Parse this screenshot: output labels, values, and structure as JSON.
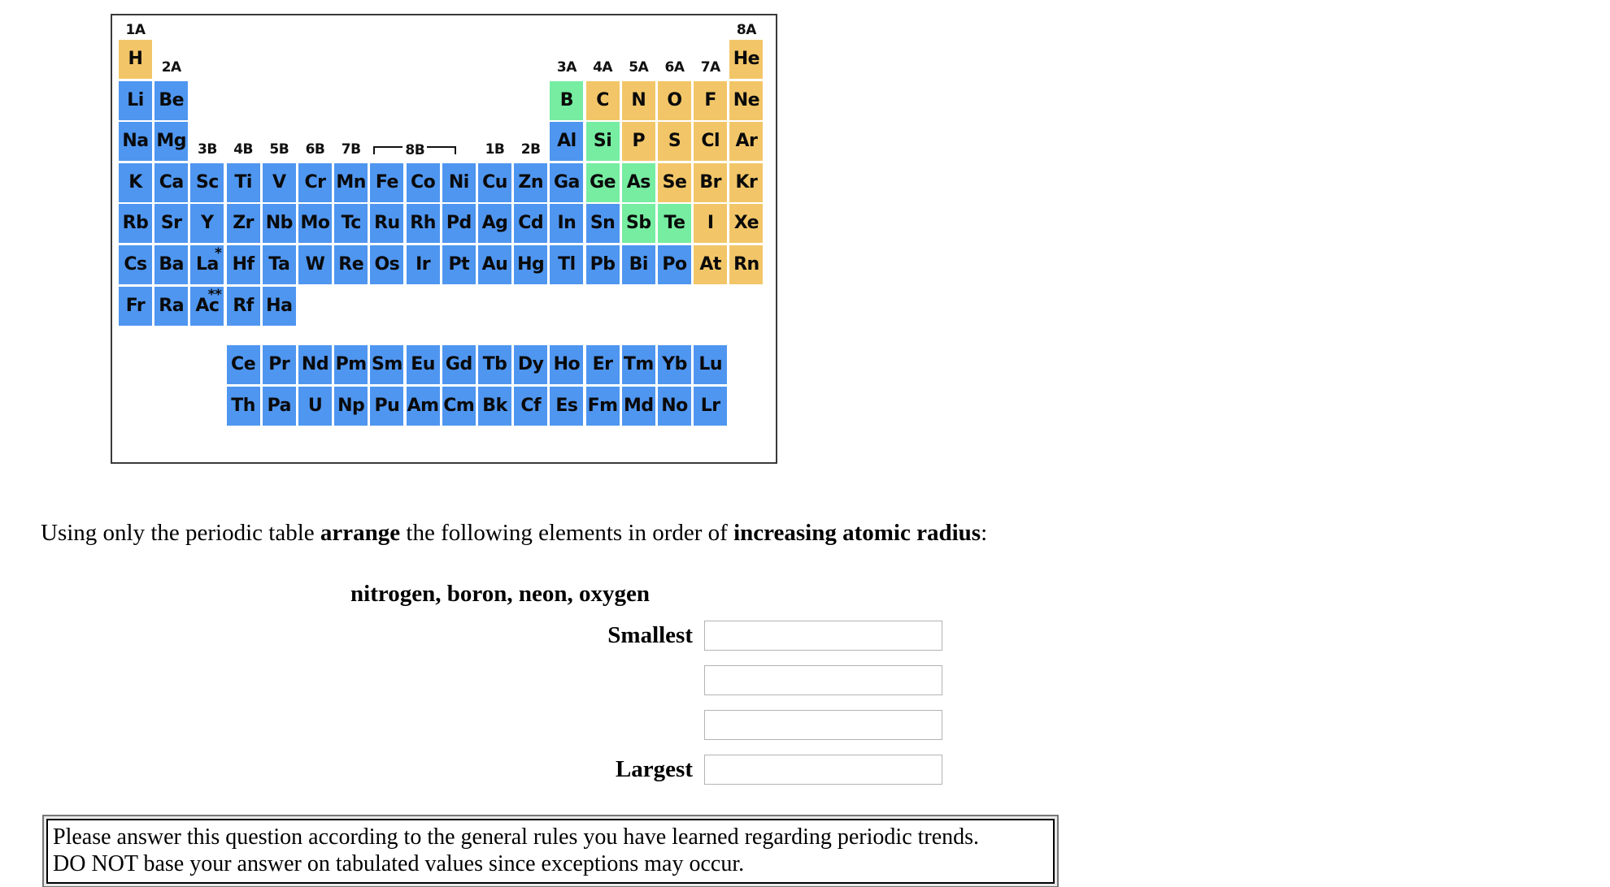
{
  "periodic_table": {
    "colors": {
      "metal": "#4f96f0",
      "metalloid": "#76eda1",
      "nonmetal": "#f2c668",
      "frame": "#3a3a3a"
    },
    "group_labels": [
      "1A",
      "2A",
      "3A",
      "4A",
      "5A",
      "6A",
      "7A",
      "8A",
      "3B",
      "4B",
      "5B",
      "6B",
      "7B",
      "8B",
      "1B",
      "2B"
    ],
    "main_rows": [
      {
        "row": 1,
        "cells": [
          {
            "sym": "H",
            "col": 1,
            "type": "nonmetal"
          },
          {
            "sym": "He",
            "col": 18,
            "type": "nonmetal"
          }
        ]
      },
      {
        "row": 2,
        "cells": [
          {
            "sym": "Li",
            "col": 1,
            "type": "metal"
          },
          {
            "sym": "Be",
            "col": 2,
            "type": "metal"
          },
          {
            "sym": "B",
            "col": 13,
            "type": "metalloid"
          },
          {
            "sym": "C",
            "col": 14,
            "type": "nonmetal"
          },
          {
            "sym": "N",
            "col": 15,
            "type": "nonmetal"
          },
          {
            "sym": "O",
            "col": 16,
            "type": "nonmetal"
          },
          {
            "sym": "F",
            "col": 17,
            "type": "nonmetal"
          },
          {
            "sym": "Ne",
            "col": 18,
            "type": "nonmetal"
          }
        ]
      },
      {
        "row": 3,
        "cells": [
          {
            "sym": "Na",
            "col": 1,
            "type": "metal"
          },
          {
            "sym": "Mg",
            "col": 2,
            "type": "metal"
          },
          {
            "sym": "Al",
            "col": 13,
            "type": "metal"
          },
          {
            "sym": "Si",
            "col": 14,
            "type": "metalloid"
          },
          {
            "sym": "P",
            "col": 15,
            "type": "nonmetal"
          },
          {
            "sym": "S",
            "col": 16,
            "type": "nonmetal"
          },
          {
            "sym": "Cl",
            "col": 17,
            "type": "nonmetal"
          },
          {
            "sym": "Ar",
            "col": 18,
            "type": "nonmetal"
          }
        ]
      },
      {
        "row": 4,
        "cells": [
          {
            "sym": "K",
            "col": 1,
            "type": "metal"
          },
          {
            "sym": "Ca",
            "col": 2,
            "type": "metal"
          },
          {
            "sym": "Sc",
            "col": 3,
            "type": "metal"
          },
          {
            "sym": "Ti",
            "col": 4,
            "type": "metal"
          },
          {
            "sym": "V",
            "col": 5,
            "type": "metal"
          },
          {
            "sym": "Cr",
            "col": 6,
            "type": "metal"
          },
          {
            "sym": "Mn",
            "col": 7,
            "type": "metal"
          },
          {
            "sym": "Fe",
            "col": 8,
            "type": "metal"
          },
          {
            "sym": "Co",
            "col": 9,
            "type": "metal"
          },
          {
            "sym": "Ni",
            "col": 10,
            "type": "metal"
          },
          {
            "sym": "Cu",
            "col": 11,
            "type": "metal"
          },
          {
            "sym": "Zn",
            "col": 12,
            "type": "metal"
          },
          {
            "sym": "Ga",
            "col": 13,
            "type": "metal"
          },
          {
            "sym": "Ge",
            "col": 14,
            "type": "metalloid"
          },
          {
            "sym": "As",
            "col": 15,
            "type": "metalloid"
          },
          {
            "sym": "Se",
            "col": 16,
            "type": "nonmetal"
          },
          {
            "sym": "Br",
            "col": 17,
            "type": "nonmetal"
          },
          {
            "sym": "Kr",
            "col": 18,
            "type": "nonmetal"
          }
        ]
      },
      {
        "row": 5,
        "cells": [
          {
            "sym": "Rb",
            "col": 1,
            "type": "metal"
          },
          {
            "sym": "Sr",
            "col": 2,
            "type": "metal"
          },
          {
            "sym": "Y",
            "col": 3,
            "type": "metal"
          },
          {
            "sym": "Zr",
            "col": 4,
            "type": "metal"
          },
          {
            "sym": "Nb",
            "col": 5,
            "type": "metal"
          },
          {
            "sym": "Mo",
            "col": 6,
            "type": "metal"
          },
          {
            "sym": "Tc",
            "col": 7,
            "type": "metal"
          },
          {
            "sym": "Ru",
            "col": 8,
            "type": "metal"
          },
          {
            "sym": "Rh",
            "col": 9,
            "type": "metal"
          },
          {
            "sym": "Pd",
            "col": 10,
            "type": "metal"
          },
          {
            "sym": "Ag",
            "col": 11,
            "type": "metal"
          },
          {
            "sym": "Cd",
            "col": 12,
            "type": "metal"
          },
          {
            "sym": "In",
            "col": 13,
            "type": "metal"
          },
          {
            "sym": "Sn",
            "col": 14,
            "type": "metal"
          },
          {
            "sym": "Sb",
            "col": 15,
            "type": "metalloid"
          },
          {
            "sym": "Te",
            "col": 16,
            "type": "metalloid"
          },
          {
            "sym": "I",
            "col": 17,
            "type": "nonmetal"
          },
          {
            "sym": "Xe",
            "col": 18,
            "type": "nonmetal"
          }
        ]
      },
      {
        "row": 6,
        "cells": [
          {
            "sym": "Cs",
            "col": 1,
            "type": "metal"
          },
          {
            "sym": "Ba",
            "col": 2,
            "type": "metal"
          },
          {
            "sym": "La",
            "col": 3,
            "type": "metal",
            "mark": "*"
          },
          {
            "sym": "Hf",
            "col": 4,
            "type": "metal"
          },
          {
            "sym": "Ta",
            "col": 5,
            "type": "metal"
          },
          {
            "sym": "W",
            "col": 6,
            "type": "metal"
          },
          {
            "sym": "Re",
            "col": 7,
            "type": "metal"
          },
          {
            "sym": "Os",
            "col": 8,
            "type": "metal"
          },
          {
            "sym": "Ir",
            "col": 9,
            "type": "metal"
          },
          {
            "sym": "Pt",
            "col": 10,
            "type": "metal"
          },
          {
            "sym": "Au",
            "col": 11,
            "type": "metal"
          },
          {
            "sym": "Hg",
            "col": 12,
            "type": "metal"
          },
          {
            "sym": "Tl",
            "col": 13,
            "type": "metal"
          },
          {
            "sym": "Pb",
            "col": 14,
            "type": "metal"
          },
          {
            "sym": "Bi",
            "col": 15,
            "type": "metal"
          },
          {
            "sym": "Po",
            "col": 16,
            "type": "metal"
          },
          {
            "sym": "At",
            "col": 17,
            "type": "nonmetal"
          },
          {
            "sym": "Rn",
            "col": 18,
            "type": "nonmetal"
          }
        ]
      },
      {
        "row": 7,
        "cells": [
          {
            "sym": "Fr",
            "col": 1,
            "type": "metal"
          },
          {
            "sym": "Ra",
            "col": 2,
            "type": "metal"
          },
          {
            "sym": "Ac",
            "col": 3,
            "type": "metal",
            "mark": "**"
          },
          {
            "sym": "Rf",
            "col": 4,
            "type": "metal"
          },
          {
            "sym": "Ha",
            "col": 5,
            "type": "metal"
          }
        ]
      }
    ],
    "lanthanides": [
      "Ce",
      "Pr",
      "Nd",
      "Pm",
      "Sm",
      "Eu",
      "Gd",
      "Tb",
      "Dy",
      "Ho",
      "Er",
      "Tm",
      "Yb",
      "Lu"
    ],
    "actinides": [
      "Th",
      "Pa",
      "U",
      "Np",
      "Pu",
      "Am",
      "Cm",
      "Bk",
      "Cf",
      "Es",
      "Fm",
      "Md",
      "No",
      "Lr"
    ]
  },
  "question": {
    "prompt_part1": "Using only the periodic table ",
    "prompt_bold1": "arrange",
    "prompt_part2": " the following elements in order of ",
    "prompt_bold2": "increasing atomic radius",
    "prompt_part3": ":",
    "elements_list": "nitrogen, boron, neon, oxygen",
    "smallest_label": "Smallest",
    "largest_label": "Largest",
    "answers": [
      "",
      "",
      "",
      ""
    ],
    "answer_placeholder": ""
  },
  "note": {
    "line1": "Please answer this question according to the general rules you have learned regarding periodic trends.",
    "line2": "DO NOT base your answer on tabulated values since exceptions may occur."
  }
}
